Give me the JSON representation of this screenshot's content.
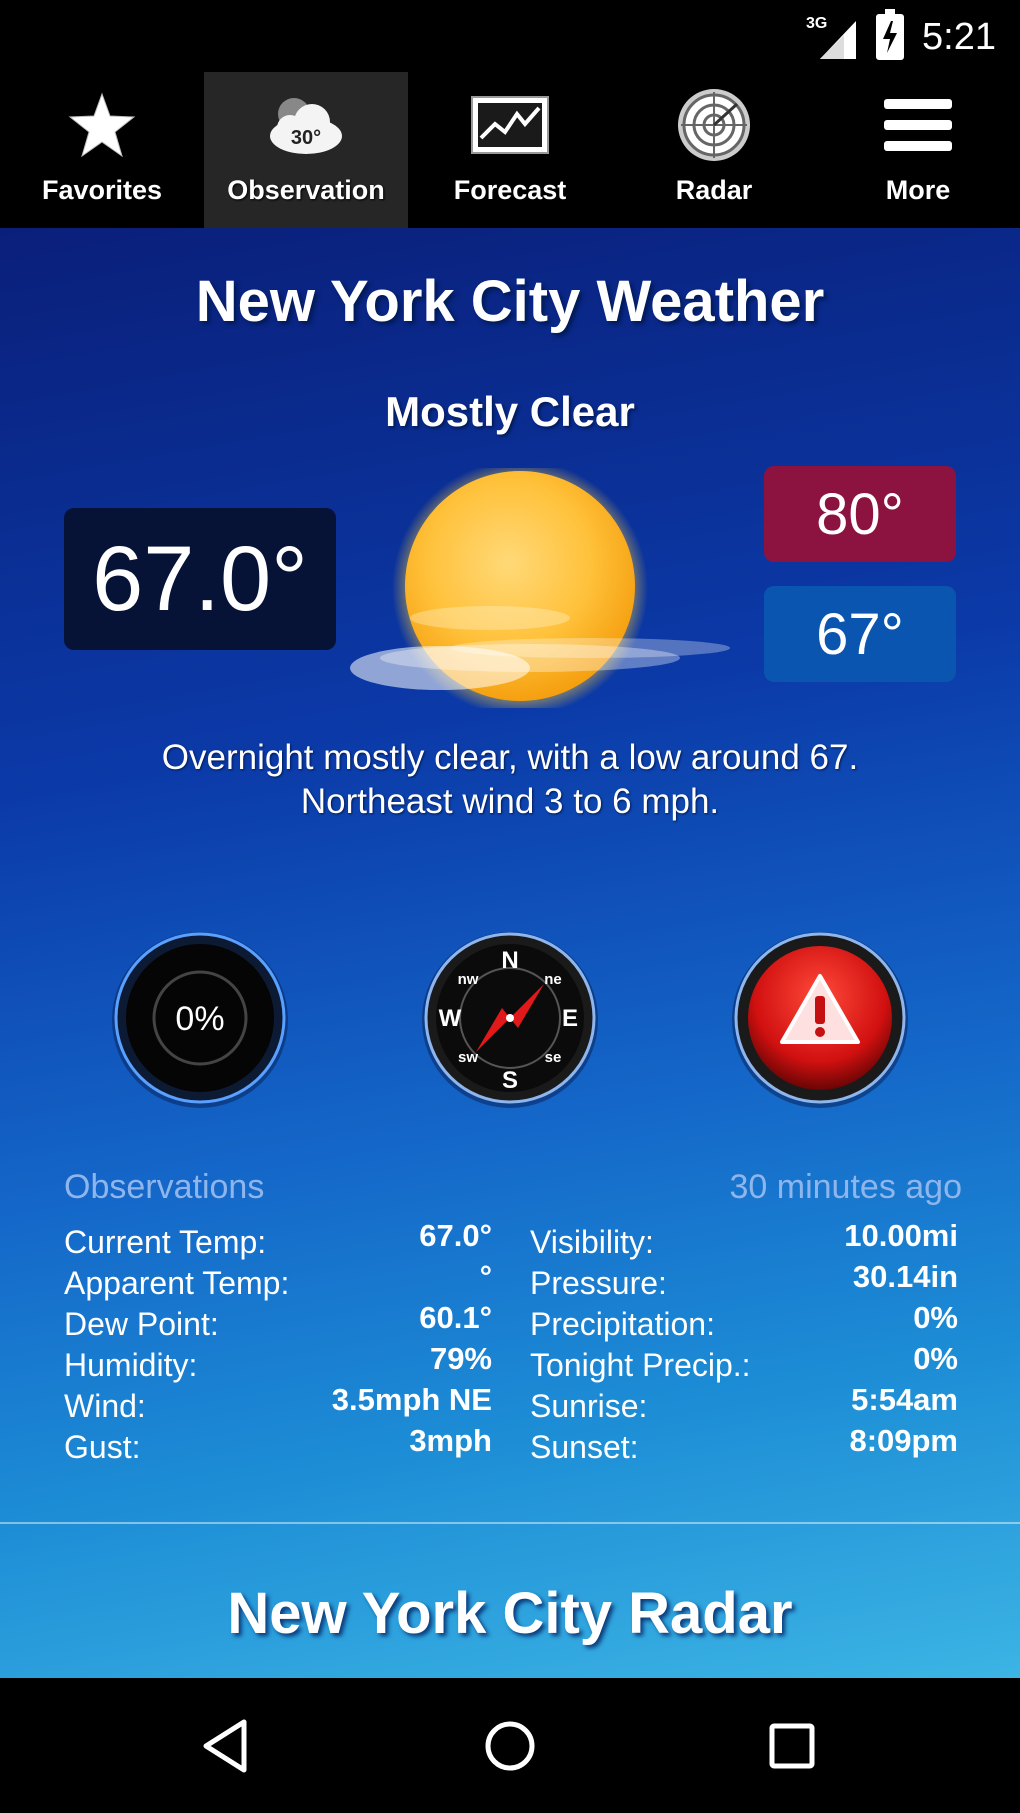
{
  "status_bar": {
    "network": "3G",
    "time": "5:21"
  },
  "nav": {
    "items": [
      {
        "label": "Favorites",
        "icon": "star-icon"
      },
      {
        "label": "Observation",
        "icon": "cloud-temp-icon",
        "icon_text": "30°",
        "active": true
      },
      {
        "label": "Forecast",
        "icon": "line-chart-icon"
      },
      {
        "label": "Radar",
        "icon": "radar-icon"
      },
      {
        "label": "More",
        "icon": "menu-icon"
      }
    ]
  },
  "weather": {
    "city_title": "New York City Weather",
    "condition": "Mostly Clear",
    "current_temp": "67.0°",
    "high": "80°",
    "low": "67°",
    "description_line1": "Overnight mostly clear, with a low around 67.",
    "description_line2": "Northeast wind 3 to 6 mph.",
    "precip_gauge": "0%",
    "compass": {
      "n": "N",
      "e": "E",
      "s": "S",
      "w": "W",
      "ne": "ne",
      "nw": "nw",
      "se": "se",
      "sw": "sw"
    }
  },
  "observations": {
    "header": "Observations",
    "updated": "30 minutes ago",
    "left": [
      {
        "label": "Current Temp:",
        "value": "67.0°"
      },
      {
        "label": "Apparent Temp:",
        "value": "°"
      },
      {
        "label": "Dew Point:",
        "value": "60.1°"
      },
      {
        "label": "Humidity:",
        "value": "79%"
      },
      {
        "label": "Wind:",
        "value": "3.5mph NE"
      },
      {
        "label": "Gust:",
        "value": "3mph"
      }
    ],
    "right": [
      {
        "label": "Visibility:",
        "value": "10.00mi"
      },
      {
        "label": "Pressure:",
        "value": "30.14in"
      },
      {
        "label": "Precipitation:",
        "value": "0%"
      },
      {
        "label": "Tonight Precip.:",
        "value": "0%"
      },
      {
        "label": "Sunrise:",
        "value": "5:54am"
      },
      {
        "label": "Sunset:",
        "value": "8:09pm"
      }
    ]
  },
  "radar": {
    "title": "New York City Radar"
  },
  "colors": {
    "high": "#8c1340",
    "low": "#0a55b0",
    "current_bg": "#061336",
    "alert": "#d81010"
  }
}
